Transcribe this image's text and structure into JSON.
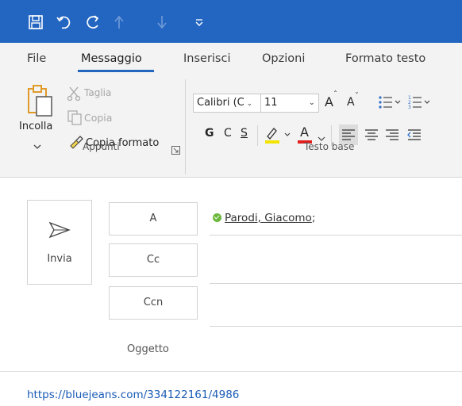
{
  "quick_access": {
    "icons": [
      "save-icon",
      "undo-icon",
      "redo-icon",
      "arrow-up-icon",
      "arrow-down-icon",
      "customize-dropdown-icon"
    ]
  },
  "tabs": [
    {
      "label": "File",
      "active": false
    },
    {
      "label": "Messaggio",
      "active": true
    },
    {
      "label": "Inserisci",
      "active": false
    },
    {
      "label": "Opzioni",
      "active": false
    },
    {
      "label": "Formato testo",
      "active": false
    }
  ],
  "ribbon": {
    "clipboard": {
      "paste_label": "Incolla",
      "cut_label": "Taglia",
      "copy_label": "Copia",
      "format_painter_label": "Copia formato",
      "group_label": "Appunti"
    },
    "basic_text": {
      "font_name": "Calibri (C",
      "font_size": "11",
      "bold": "G",
      "italic": "C",
      "underline": "S",
      "font_color_letter": "A",
      "grow_font": "A",
      "shrink_font": "A",
      "group_label": "Testo base"
    }
  },
  "compose": {
    "send_label": "Invia",
    "to_label": "A",
    "cc_label": "Cc",
    "bcc_label": "Ccn",
    "subject_label": "Oggetto",
    "to_recipient": "Parodi, Giacomo",
    "recipient_separator": ";",
    "body_link": "https://bluejeans.com/334122161/4986"
  },
  "colors": {
    "titlebar": "#2366c2",
    "accent": "#2366c2",
    "presence_available": "#6bb83c",
    "highlight_yellow": "#f2e400",
    "font_color_red": "#e01e1e",
    "link": "#1a5bb6"
  }
}
